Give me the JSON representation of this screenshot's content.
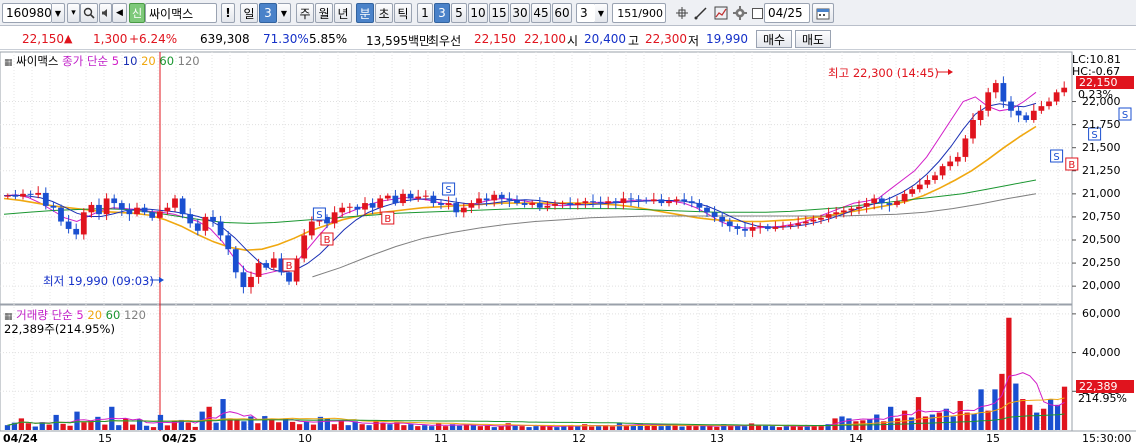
{
  "toolbar": {
    "code": "160980",
    "market_badge": "신",
    "name": "싸이맥스",
    "info_btn": "!",
    "period_day": "일",
    "period_num": "3",
    "week": "주",
    "month": "월",
    "year": "년",
    "minute": "분",
    "second": "초",
    "tick": "틱",
    "intervals": [
      "1",
      "3",
      "5",
      "10",
      "15",
      "30",
      "45",
      "60"
    ],
    "interval_custom": "3",
    "count": "151",
    "count_max": "/900",
    "date": "04/25"
  },
  "quote": {
    "price": "22,150",
    "change": "1,300",
    "change_pct": "+6.24%",
    "volume": "639,308",
    "vol_ratio": "71.30%",
    "turnover": "5.85%",
    "amount": "13,595백만",
    "best_ask_label": "최우선",
    "best_ask": "22,150",
    "best_bid": "22,100",
    "open_label": "시",
    "open": "20,400",
    "high_label": "고",
    "high": "22,300",
    "low_label": "저",
    "low": "19,990",
    "buy_btn": "매수",
    "sell_btn": "매도"
  },
  "chart": {
    "stock_tag": "싸이맥스",
    "price_legend_label": "종가 단순",
    "ma_periods": [
      "5",
      "10",
      "20",
      "60",
      "120"
    ],
    "volume_legend_label": "거래량 단순",
    "volume_readout": "22,389주(214.95%)",
    "lc_label": "LC:10.81",
    "hc_label": "HC:-0.67",
    "price_tag": "22,150",
    "pct_tag": "0.23%",
    "vol_tag": "22,389",
    "vol_pct_tag": "214.95%",
    "high_annotation": "최고 22,300 (14:45)",
    "low_annotation": "최저 19,990 (09:03)",
    "signal_sell": "S",
    "signal_buy": "B",
    "time_label": "15:30:00",
    "x_labels": [
      "04/24",
      "15",
      "04/25",
      "10",
      "11",
      "12",
      "13",
      "14",
      "15"
    ],
    "colors": {
      "up": "#e0141e",
      "down": "#1a4fd0",
      "ma5": "#d21ec8",
      "ma10": "#1a2fb4",
      "ma20": "#f0a810",
      "ma60": "#1a9630",
      "ma120": "#808080"
    }
  },
  "chart_data": [
    {
      "type": "candlestick",
      "title": "싸이맥스",
      "y_ticks": [
        20000,
        20250,
        20500,
        20750,
        21000,
        21250,
        21500,
        21750,
        22000
      ],
      "ylim": [
        19850,
        22450
      ],
      "x_labels": [
        "04/24",
        "15",
        "04/25",
        "10",
        "11",
        "12",
        "13",
        "14",
        "15"
      ],
      "series": [
        {
          "name": "종가",
          "values": [
            20980,
            20970,
            21000,
            20990,
            21010,
            20870,
            20850,
            20700,
            20620,
            20560,
            20800,
            20880,
            20780,
            20950,
            20900,
            20830,
            20780,
            20850,
            20800,
            20740,
            20810,
            20850,
            20950,
            20780,
            20680,
            20600,
            20750,
            20700,
            20550,
            20400,
            20150,
            19990,
            20100,
            20250,
            20200,
            20300,
            20150,
            20050,
            20300,
            20550,
            20700,
            20750,
            20680,
            20800,
            20850,
            20860,
            20830,
            20900,
            20850,
            20950,
            20980,
            20900,
            21000,
            20950,
            20970,
            20980,
            20900,
            20880,
            20900,
            20800,
            20850,
            20900,
            20950,
            20930,
            20990,
            20950,
            20930,
            20900,
            20880,
            20900,
            20850,
            20870,
            20890,
            20900,
            20880,
            20900,
            20920,
            20910,
            20900,
            20920,
            20900,
            20950,
            20940,
            20930,
            20920,
            20940,
            20900,
            20920,
            20940,
            20920,
            20900,
            20850,
            20800,
            20750,
            20700,
            20650,
            20620,
            20600,
            20640,
            20650,
            20620,
            20640,
            20650,
            20660,
            20680,
            20700,
            20720,
            20740,
            20780,
            20800,
            20820,
            20840,
            20860,
            20900,
            20950,
            20900,
            20880,
            20920,
            21000,
            21050,
            21100,
            21150,
            21200,
            21300,
            21350,
            21400,
            21600,
            21800,
            21900,
            22100,
            22200,
            22000,
            21900,
            21850,
            21800,
            21900,
            21950,
            22000,
            22100,
            22150
          ]
        },
        {
          "name": "5",
          "values": [
            20980,
            20990,
            20960,
            20900,
            20820,
            20740,
            20700,
            20760,
            20820,
            20850,
            20840,
            20830,
            20810,
            20800,
            20780,
            20740,
            20700,
            20620,
            20480,
            20300,
            20160,
            20120,
            20150,
            20180,
            20250,
            20400,
            20560,
            20700,
            20780,
            20830,
            20880,
            20920,
            20940,
            20960,
            20950,
            20930,
            20900,
            20880,
            20870,
            20900,
            20930,
            20950,
            20940,
            20920,
            20900,
            20880,
            20870,
            20880,
            20900,
            20910,
            20910,
            20920,
            20930,
            20930,
            20930,
            20920,
            20900,
            20850,
            20780,
            20700,
            20650,
            20630,
            20630,
            20640,
            20650,
            20670,
            20700,
            20750,
            20800,
            20850,
            20900,
            20920,
            20950,
            21050,
            21150,
            21250,
            21400,
            21600,
            21800,
            22000,
            22050,
            21950,
            21900,
            21920,
            22000,
            22100
          ]
        },
        {
          "name": "20",
          "values": [
            20950,
            20930,
            20900,
            20870,
            20850,
            20830,
            20810,
            20800,
            20790,
            20770,
            20720,
            20650,
            20560,
            20480,
            20420,
            20390,
            20400,
            20450,
            20520,
            20600,
            20660,
            20720,
            20760,
            20790,
            20810,
            20830,
            20850,
            20860,
            20870,
            20880,
            20890,
            20900,
            20900,
            20900,
            20900,
            20900,
            20900,
            20890,
            20880,
            20860,
            20830,
            20800,
            20770,
            20740,
            20720,
            20710,
            20700,
            20700,
            20710,
            20720,
            20740,
            20760,
            20790,
            20820,
            20850,
            20880,
            20920,
            20980,
            21060,
            21150,
            21250,
            21370,
            21500,
            21620,
            21730
          ]
        },
        {
          "name": "60",
          "values": [
            20780,
            20800,
            20820,
            20830,
            20840,
            20830,
            20800,
            20760,
            20720,
            20690,
            20680,
            20690,
            20710,
            20730,
            20750,
            20770,
            20790,
            20800,
            20810,
            20820,
            20830,
            20840,
            20840,
            20840,
            20840,
            20840,
            20830,
            20820,
            20810,
            20800,
            20800,
            20800,
            20810,
            20830,
            20850,
            20880,
            20910,
            20940,
            20970,
            21000,
            21050,
            21100,
            21150
          ]
        },
        {
          "name": "120",
          "values": [
            20100,
            20200,
            20320,
            20430,
            20520,
            20580,
            20630,
            20670,
            20700,
            20720,
            20740,
            20750,
            20760,
            20760,
            20760,
            20760,
            20760,
            20760,
            20760,
            20760,
            20770,
            20780,
            20800,
            20840,
            20890,
            20950,
            21000
          ]
        }
      ]
    },
    {
      "type": "bar",
      "title": "거래량",
      "y_ticks": [
        20000,
        40000,
        60000
      ],
      "ylim": [
        0,
        62000
      ],
      "series": [
        {
          "name": "거래량",
          "values": [
            2500,
            3800,
            6000,
            3500,
            1800,
            4000,
            2800,
            7800,
            3200,
            2200,
            9500,
            4000,
            4800,
            6800,
            2800,
            12000,
            2500,
            6000,
            2800,
            5500,
            2200,
            1500,
            7800,
            2400,
            4800,
            5200,
            3900,
            1600,
            9500,
            12000,
            3800,
            16000,
            6000,
            5500,
            4500,
            7000,
            3500,
            7200,
            5500,
            4000,
            6000,
            4200,
            3000,
            4400,
            2800,
            6800,
            6000,
            3000,
            5000,
            2500,
            4500,
            3000,
            2500,
            4800,
            3500,
            3000,
            4000,
            2500,
            3000,
            2000,
            2500,
            2000,
            3500,
            2000,
            3000,
            2200,
            3000,
            2500,
            2000,
            2200,
            1500,
            2000,
            3500,
            2500,
            2000,
            1500,
            2000,
            2500,
            1800,
            1500,
            2000,
            2500,
            2200,
            3000,
            1800,
            2000,
            2500,
            1800,
            3800,
            2200,
            2800,
            3500,
            2400,
            3000,
            2000,
            2800,
            2400,
            1800,
            2400,
            2000,
            2200,
            2000,
            1600,
            3000,
            2000,
            2500,
            2000,
            3400,
            2800,
            2200,
            2000,
            1500,
            2000,
            2500,
            1800,
            2000,
            2200,
            2600,
            3000,
            6000,
            7000,
            6000,
            4500,
            5000,
            5500,
            8000,
            4500,
            12000,
            6000,
            10000,
            6500,
            17000,
            7000,
            8000,
            9000,
            11000,
            7000,
            15000,
            9000,
            8500,
            21000,
            10000,
            21000,
            29000,
            58000,
            24000,
            16000,
            13000,
            9000,
            11000,
            16000,
            13000,
            22389
          ]
        }
      ]
    }
  ]
}
